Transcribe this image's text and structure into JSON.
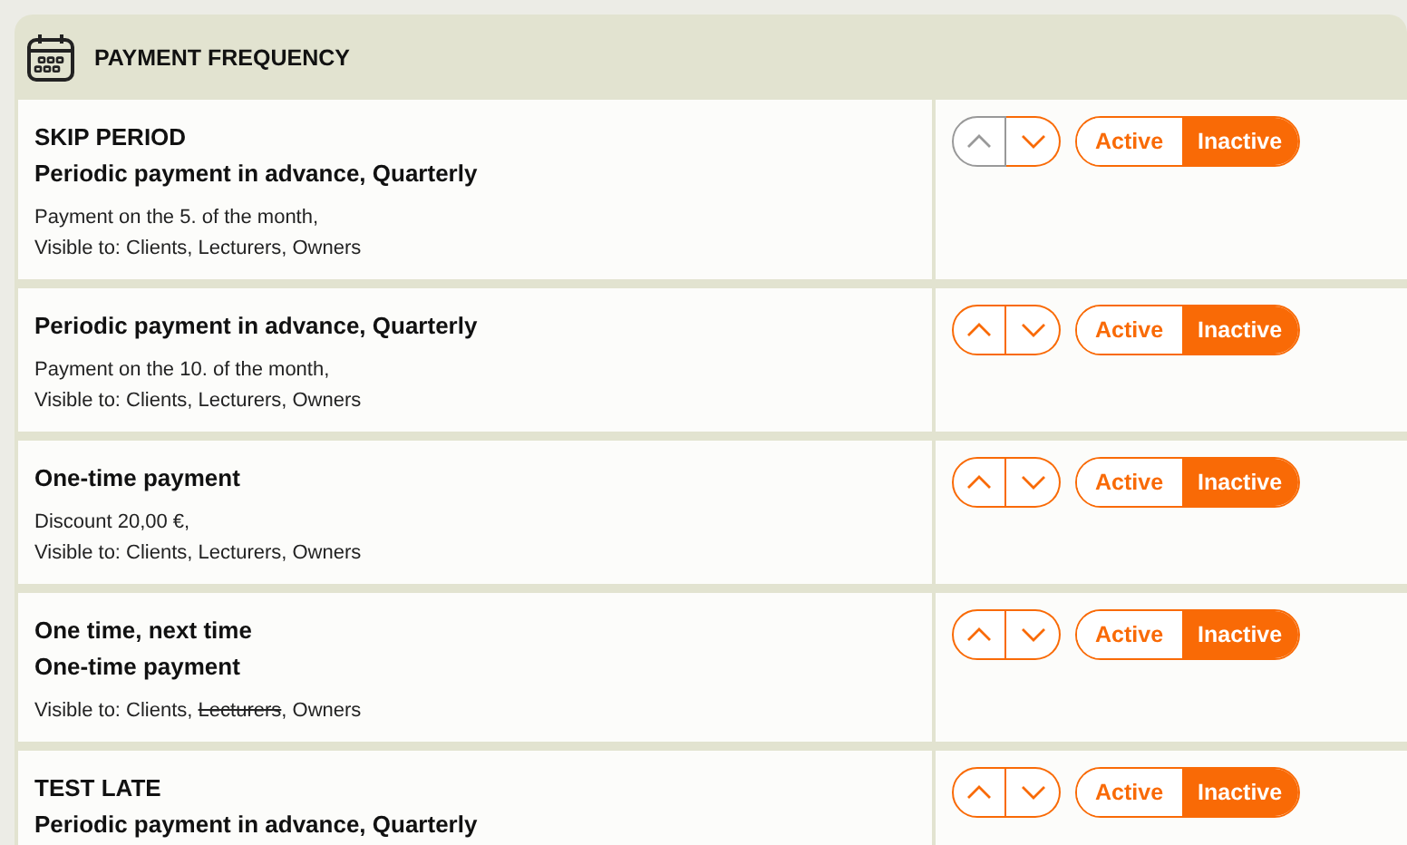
{
  "panel": {
    "title": "PAYMENT FREQUENCY"
  },
  "rules": [
    {
      "lines": [
        "SKIP PERIOD",
        "Periodic payment in advance, Quarterly"
      ],
      "detail": "Payment on the 5. of the month,",
      "visibility": [
        {
          "text": "Visible to: Clients, Lecturers, Owners",
          "struck": false
        }
      ],
      "move_up_disabled": true,
      "move_down_disabled": false,
      "status": [
        {
          "label": "Active",
          "selected": false
        },
        {
          "label": "Inactive",
          "selected": true
        }
      ]
    },
    {
      "lines": [
        "Periodic payment in advance, Quarterly"
      ],
      "detail": "Payment on the 10. of the month,",
      "visibility": [
        {
          "text": "Visible to: Clients, Lecturers, Owners",
          "struck": false
        }
      ],
      "move_up_disabled": false,
      "move_down_disabled": false,
      "status": [
        {
          "label": "Active",
          "selected": false
        },
        {
          "label": "Inactive",
          "selected": true
        }
      ]
    },
    {
      "lines": [
        "One-time payment"
      ],
      "detail": "Discount 20,00 €,",
      "visibility": [
        {
          "text": "Visible to: Clients, Lecturers, Owners",
          "struck": false
        }
      ],
      "move_up_disabled": false,
      "move_down_disabled": false,
      "status": [
        {
          "label": "Active",
          "selected": false
        },
        {
          "label": "Inactive",
          "selected": true
        }
      ]
    },
    {
      "lines": [
        "One time, next time",
        "One-time payment"
      ],
      "visibility": [
        {
          "text": "Visible to: Clients, ",
          "struck": false
        },
        {
          "text": "Lecturers",
          "struck": true
        },
        {
          "text": ", Owners",
          "struck": false
        }
      ],
      "move_up_disabled": false,
      "move_down_disabled": false,
      "status": [
        {
          "label": "Active",
          "selected": false
        },
        {
          "label": "Inactive",
          "selected": true
        }
      ]
    },
    {
      "lines": [
        "TEST LATE",
        "Periodic payment in advance, Quarterly"
      ],
      "move_up_disabled": false,
      "move_down_disabled": false,
      "status": [
        {
          "label": "Active",
          "selected": false
        },
        {
          "label": "Inactive",
          "selected": true
        }
      ]
    }
  ]
}
